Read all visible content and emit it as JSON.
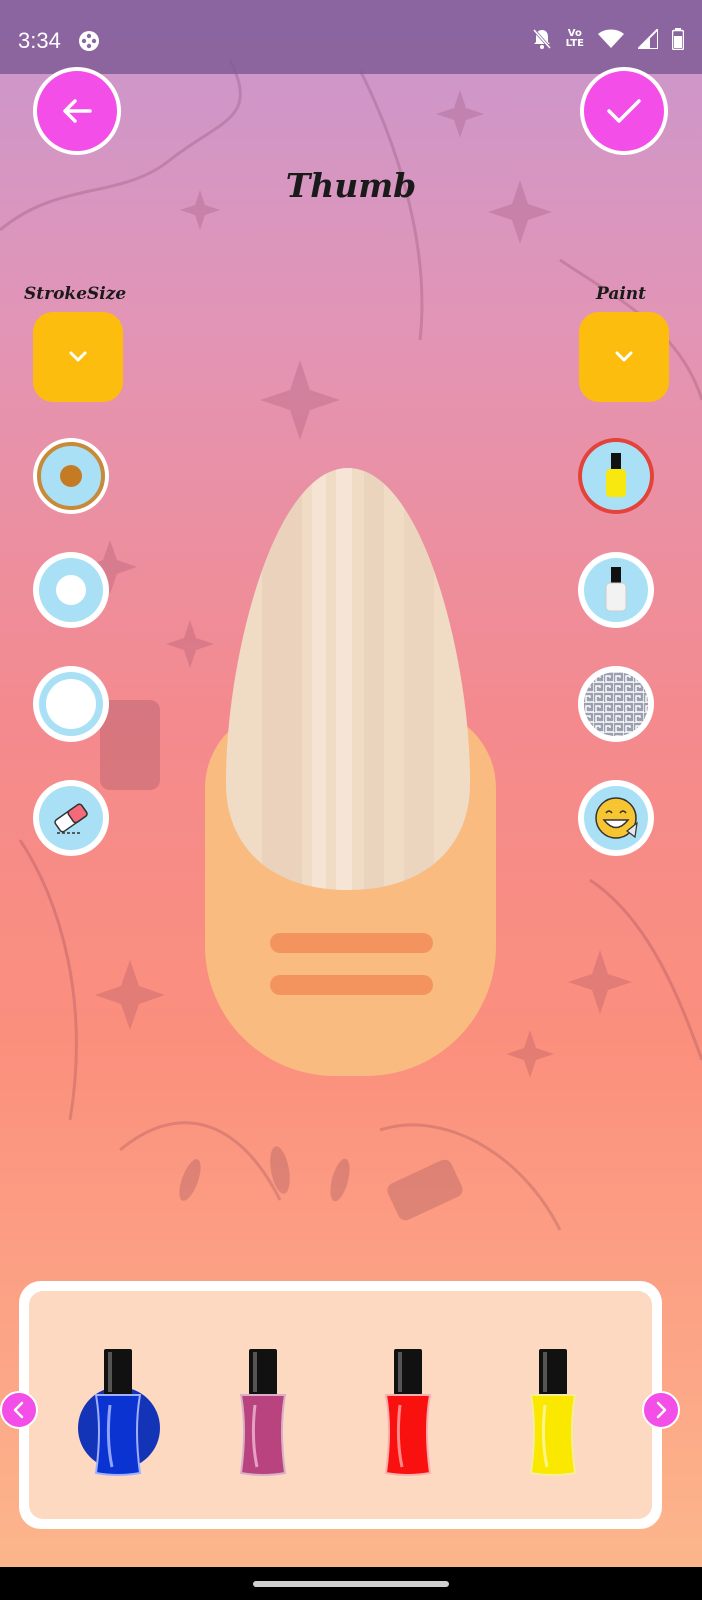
{
  "status_bar": {
    "time": "3:34",
    "network_label": "LTE",
    "icons": [
      "app-status-icon",
      "bell-off-icon",
      "volte-icon",
      "wifi-icon",
      "signal-icon",
      "battery-icon"
    ]
  },
  "header": {
    "title": "Thumb",
    "back_icon": "arrow-left-icon",
    "done_icon": "check-icon"
  },
  "left_panel": {
    "label": "StrokeSize",
    "dropdown_icon": "chevron-down-icon",
    "tools": [
      {
        "name": "stroke-size-small",
        "selected": true
      },
      {
        "name": "stroke-size-medium",
        "selected": false
      },
      {
        "name": "stroke-size-large",
        "selected": false
      },
      {
        "name": "eraser",
        "selected": false
      }
    ]
  },
  "right_panel": {
    "label": "Paint",
    "dropdown_icon": "chevron-down-icon",
    "tools": [
      {
        "name": "polish-color",
        "selected": true
      },
      {
        "name": "polish-clear",
        "selected": false
      },
      {
        "name": "pattern",
        "selected": false
      },
      {
        "name": "sticker",
        "selected": false
      }
    ]
  },
  "colors": {
    "accent": "#f34ee7",
    "dropdown": "#fdbd0e",
    "tool_bg": "#a9e0f6",
    "finger": "#f9bb80",
    "nail": "#f0dbc5"
  },
  "palette": {
    "bottles": [
      {
        "color": "#0b33d1",
        "selected": true
      },
      {
        "color": "#b8437e",
        "selected": false
      },
      {
        "color": "#f8110f",
        "selected": false
      },
      {
        "color": "#fbe800",
        "selected": false
      }
    ],
    "prev_icon": "chevron-left-icon",
    "next_icon": "chevron-right-icon"
  }
}
